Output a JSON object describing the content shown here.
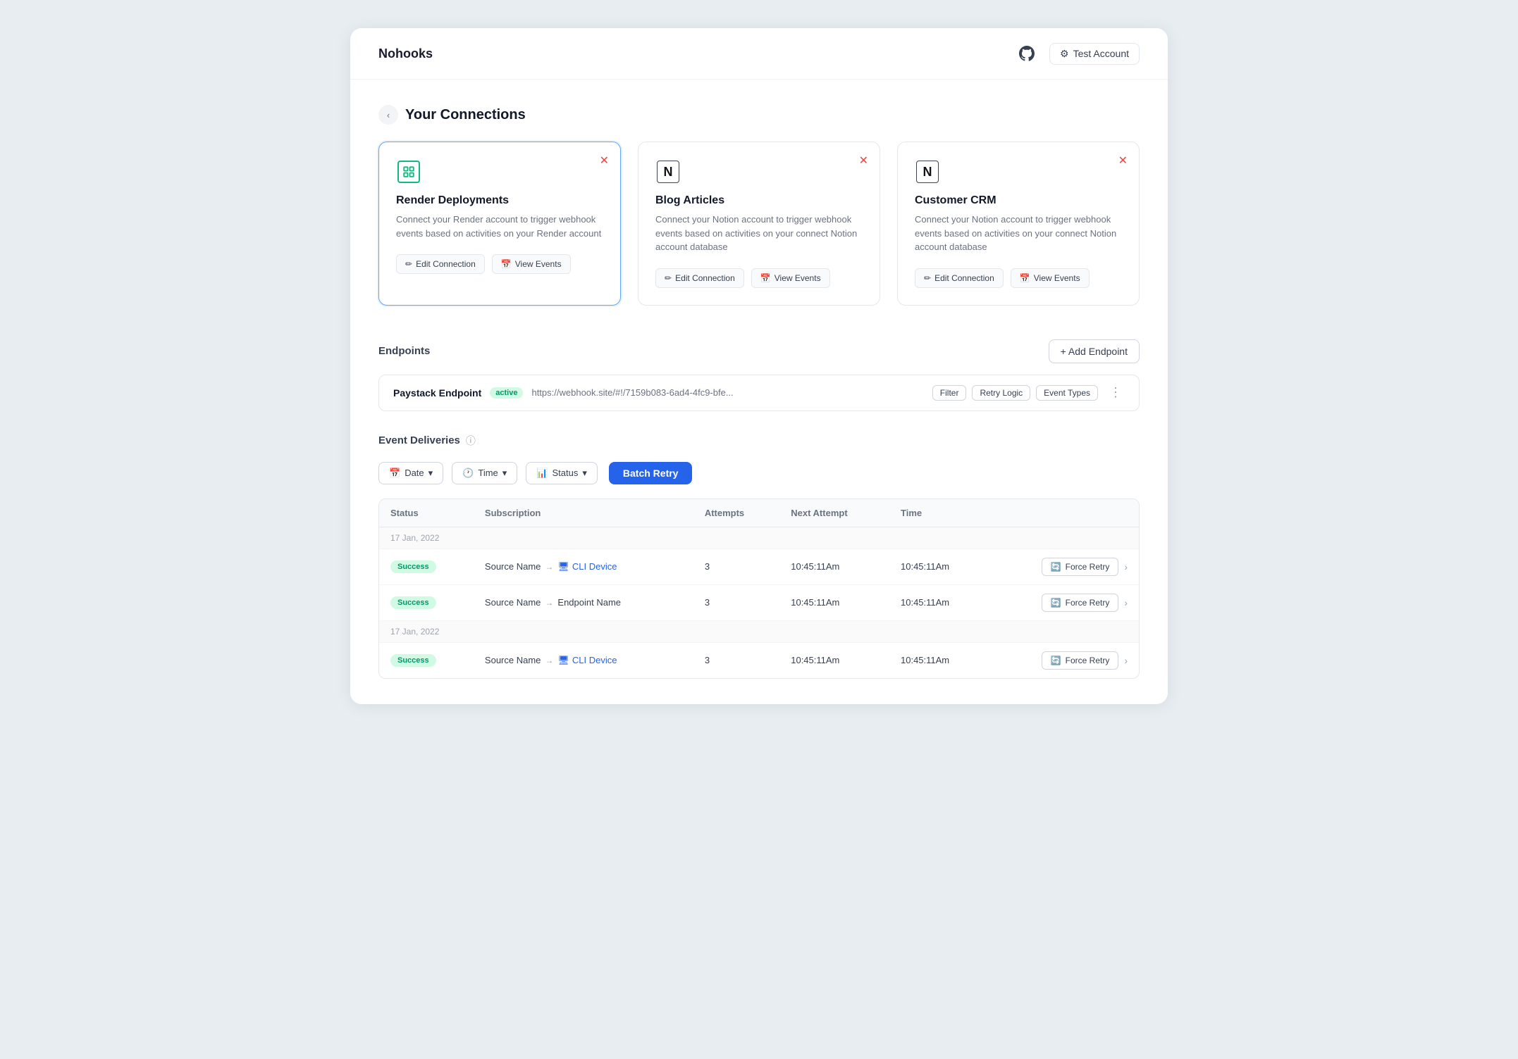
{
  "header": {
    "logo": "Nohooks",
    "github_icon": "github",
    "test_account_label": "Test Account"
  },
  "connections": {
    "section_title": "Your Connections",
    "back_label": "‹",
    "cards": [
      {
        "id": "render",
        "title": "Render Deployments",
        "description": "Connect your Render account to trigger webhook events based on activities on your Render account",
        "icon_type": "render",
        "active": true,
        "edit_label": "Edit Connection",
        "view_label": "View Events"
      },
      {
        "id": "blog",
        "title": "Blog Articles",
        "description": "Connect your Notion account to trigger webhook events based on activities on your connect Notion account database",
        "icon_type": "notion",
        "active": false,
        "edit_label": "Edit Connection",
        "view_label": "View Events"
      },
      {
        "id": "crm",
        "title": "Customer CRM",
        "description": "Connect your Notion account to trigger webhook events based on activities on your connect Notion account database",
        "icon_type": "notion",
        "active": false,
        "edit_label": "Edit Connection",
        "view_label": "View Events"
      }
    ]
  },
  "endpoints": {
    "section_title": "Endpoints",
    "add_label": "+ Add Endpoint",
    "endpoint": {
      "name": "Paystack Endpoint",
      "status": "active",
      "url": "https://webhook.site/#!/7159b083-6ad4-4fc9-bfe...",
      "tags": [
        "Filter",
        "Retry Logic",
        "Event Types"
      ]
    }
  },
  "event_deliveries": {
    "section_title": "Event Deliveries",
    "filters": {
      "date_label": "Date",
      "time_label": "Time",
      "status_label": "Status"
    },
    "batch_retry_label": "Batch Retry",
    "table": {
      "columns": [
        "Status",
        "Subscription",
        "Attempts",
        "Next Attempt",
        "Time"
      ],
      "date_groups": [
        {
          "date": "17 Jan, 2022",
          "rows": [
            {
              "status": "Success",
              "source": "Source Name",
              "destination": "CLI Device",
              "destination_type": "cli",
              "attempts": "3",
              "next_attempt": "10:45:11Am",
              "time": "10:45:11Am"
            },
            {
              "status": "Success",
              "source": "Source Name",
              "destination": "Endpoint Name",
              "destination_type": "endpoint",
              "attempts": "3",
              "next_attempt": "10:45:11Am",
              "time": "10:45:11Am"
            }
          ]
        },
        {
          "date": "17 Jan, 2022",
          "rows": [
            {
              "status": "Success",
              "source": "Source Name",
              "destination": "CLI Device",
              "destination_type": "cli",
              "attempts": "3",
              "next_attempt": "10:45:11Am",
              "time": "10:45:11Am"
            }
          ]
        }
      ],
      "force_retry_label": "Force Retry"
    }
  }
}
